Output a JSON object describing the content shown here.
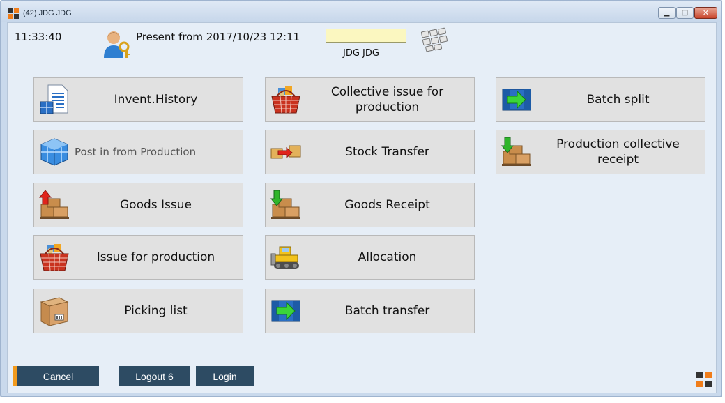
{
  "window": {
    "title": "(42) JDG JDG",
    "controls": {
      "minimize": "▁",
      "maximize": "□",
      "close": "✕"
    }
  },
  "header": {
    "clock": "11:33:40",
    "present_text": "Present from 2017/10/23 12:11",
    "scan_value": "",
    "user_name": "JDG JDG"
  },
  "tiles": {
    "invent_history": "Invent.History",
    "post_in_production": "Post in from Production",
    "goods_issue": "Goods Issue",
    "issue_for_production": "Issue for production",
    "picking_list": "Picking list",
    "collective_issue": "Collective issue for production",
    "stock_transfer": "Stock Transfer",
    "goods_receipt": "Goods Receipt",
    "allocation": "Allocation",
    "batch_transfer": "Batch transfer",
    "batch_split": "Batch split",
    "production_collective_receipt": "Production collective receipt"
  },
  "footer": {
    "cancel": "Cancel",
    "logout": "Logout 6",
    "login": "Login"
  },
  "colors": {
    "tile_bg": "#e1e1e1",
    "footer_button": "#2d4b63",
    "cancel_accent": "#f29a1c",
    "brand_orange": "#f07d1a"
  }
}
